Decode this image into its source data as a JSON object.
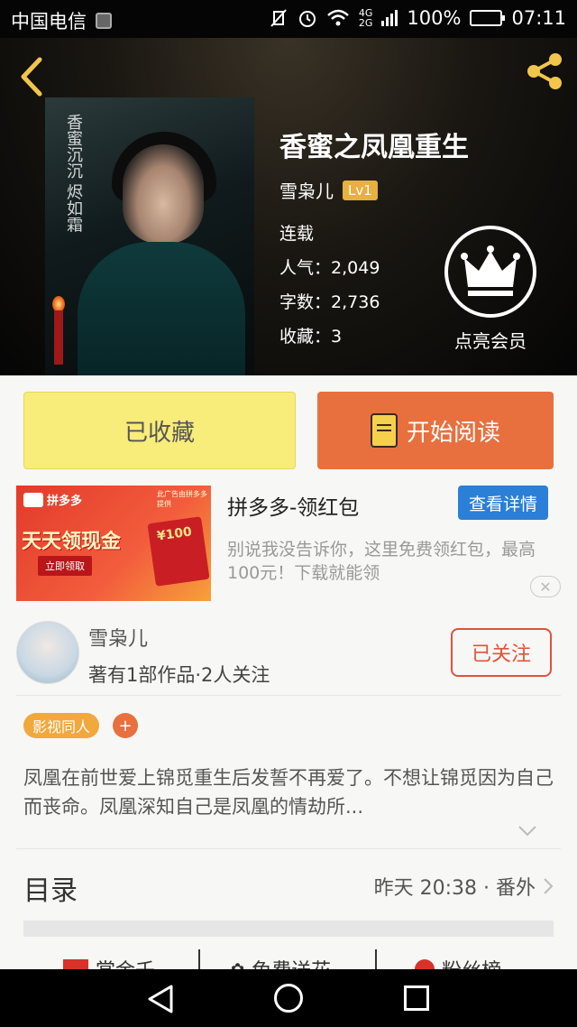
{
  "status_bar": {
    "carrier": "中国电信",
    "network_top": "4G",
    "network_bottom": "2G",
    "battery": "100%",
    "time": "07:11"
  },
  "book": {
    "title": "香蜜之凤凰重生",
    "author": "雪枭儿",
    "level": "Lv1",
    "status": "连载",
    "popularity_label": "人气：",
    "popularity": "2,049",
    "word_count_label": "字数：",
    "word_count": "2,736",
    "favorites_label": "收藏：",
    "favorites": "3",
    "vip_label": "点亮会员",
    "cover_calligraphy": "香蜜沉沉 烬如霜"
  },
  "actions": {
    "collected_label": "已收藏",
    "read_label": "开始阅读"
  },
  "ad": {
    "brand": "拼多多",
    "banner_note": "此广告由拼多多提供",
    "banner_slogan": "天天领现金",
    "banner_button": "立即领取",
    "banner_amount": "¥100",
    "title": "拼多多-领红包",
    "detail_button": "查看详情",
    "description": "别说我没告诉你，这里免费领红包，最高100元！下载就能领"
  },
  "author_card": {
    "name": "雪枭儿",
    "stats": "著有1部作品·2人关注",
    "follow_label": "已关注"
  },
  "tags": {
    "tag1": "影视同人",
    "add": "+"
  },
  "synopsis": "凤凰在前世爱上锦觅重生后发誓不再爱了。不想让锦觅因为自己而丧命。凤凰深知自己是凤凰的情劫所...",
  "toc": {
    "label": "目录",
    "latest": "昨天 20:38 · 番外"
  },
  "bottom_tabs": [
    "赏金壬",
    "免费送花",
    "粉丝榜"
  ],
  "colors": {
    "accent_orange": "#e8703e",
    "collected_yellow": "#f8ec7a",
    "tag_orange": "#f1a83c",
    "ad_blue": "#2b7fd6",
    "follow_red": "#e0523a"
  }
}
